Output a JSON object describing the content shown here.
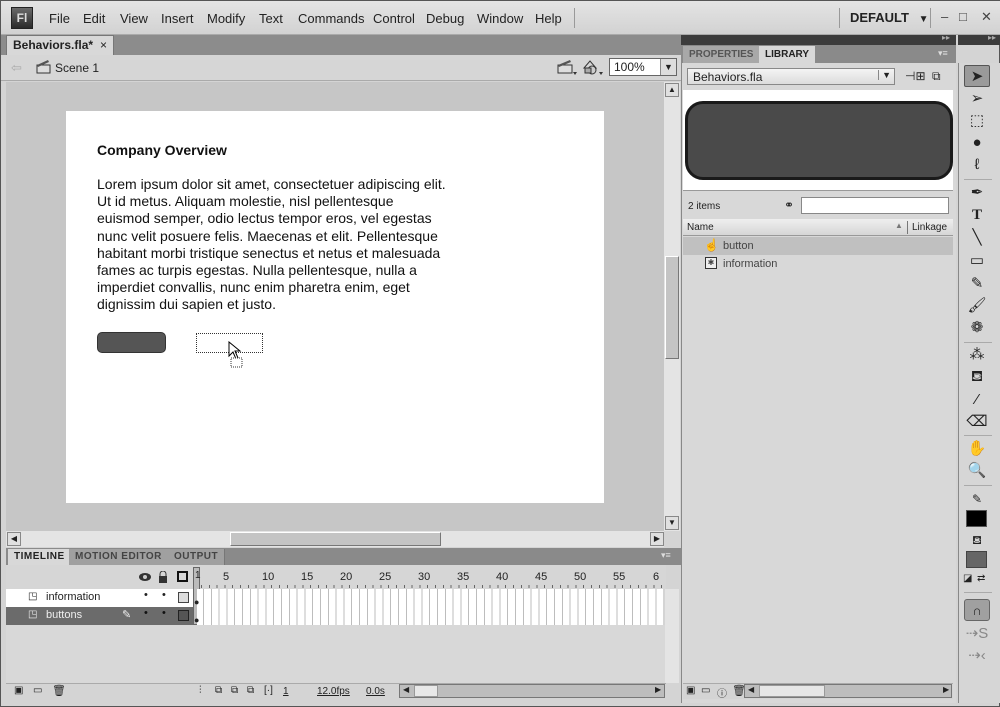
{
  "app": {
    "logo": "Fl"
  },
  "menu": [
    "File",
    "Edit",
    "View",
    "Insert",
    "Modify",
    "Text",
    "Commands",
    "Control",
    "Debug",
    "Window",
    "Help"
  ],
  "workspace": {
    "label": "DEFAULT",
    "arrow": "▼"
  },
  "window_controls": {
    "minimize": "–",
    "maximize": "□",
    "close": "✕"
  },
  "document": {
    "tab_label": "Behaviors.fla*",
    "close": "×"
  },
  "scene": {
    "back": "⇦",
    "label": "Scene 1",
    "zoom": "100%"
  },
  "stage": {
    "title": "Company Overview",
    "body": "Lorem ipsum dolor sit amet, consectetuer adipiscing elit. Ut id metus. Aliquam molestie, nisl pellentesque euismod semper, odio lectus tempor eros, vel egestas nunc velit posuere felis. Maecenas et elit. Pellentesque habitant morbi tristique senectus et netus et malesuada fames ac turpis egestas. Nulla pellentesque, nulla a imperdiet convallis, nunc enim pharetra enim, eget dignissim dui sapien et justo."
  },
  "timeline": {
    "tabs": [
      "TIMELINE",
      "MOTION EDITOR",
      "OUTPUT"
    ],
    "frame_numbers": [
      "1",
      "5",
      "10",
      "15",
      "20",
      "25",
      "30",
      "35",
      "40",
      "45",
      "50",
      "55",
      "6"
    ],
    "layers": [
      {
        "name": "information",
        "selected": false
      },
      {
        "name": "buttons",
        "selected": true
      }
    ],
    "footer": {
      "current_frame": "1",
      "fps": "12.0fps",
      "time": "0.0s"
    }
  },
  "library": {
    "tabs": [
      "PROPERTIES",
      "LIBRARY"
    ],
    "file": "Behaviors.fla",
    "count": "2 items",
    "search": "",
    "columns": {
      "name": "Name",
      "linkage": "Linkage"
    },
    "items": [
      {
        "name": "button",
        "type": "button-symbol",
        "selected": true
      },
      {
        "name": "information",
        "type": "movieclip-symbol",
        "selected": false
      }
    ]
  },
  "colors": {
    "stroke": "#000000",
    "fill": "#666666"
  }
}
